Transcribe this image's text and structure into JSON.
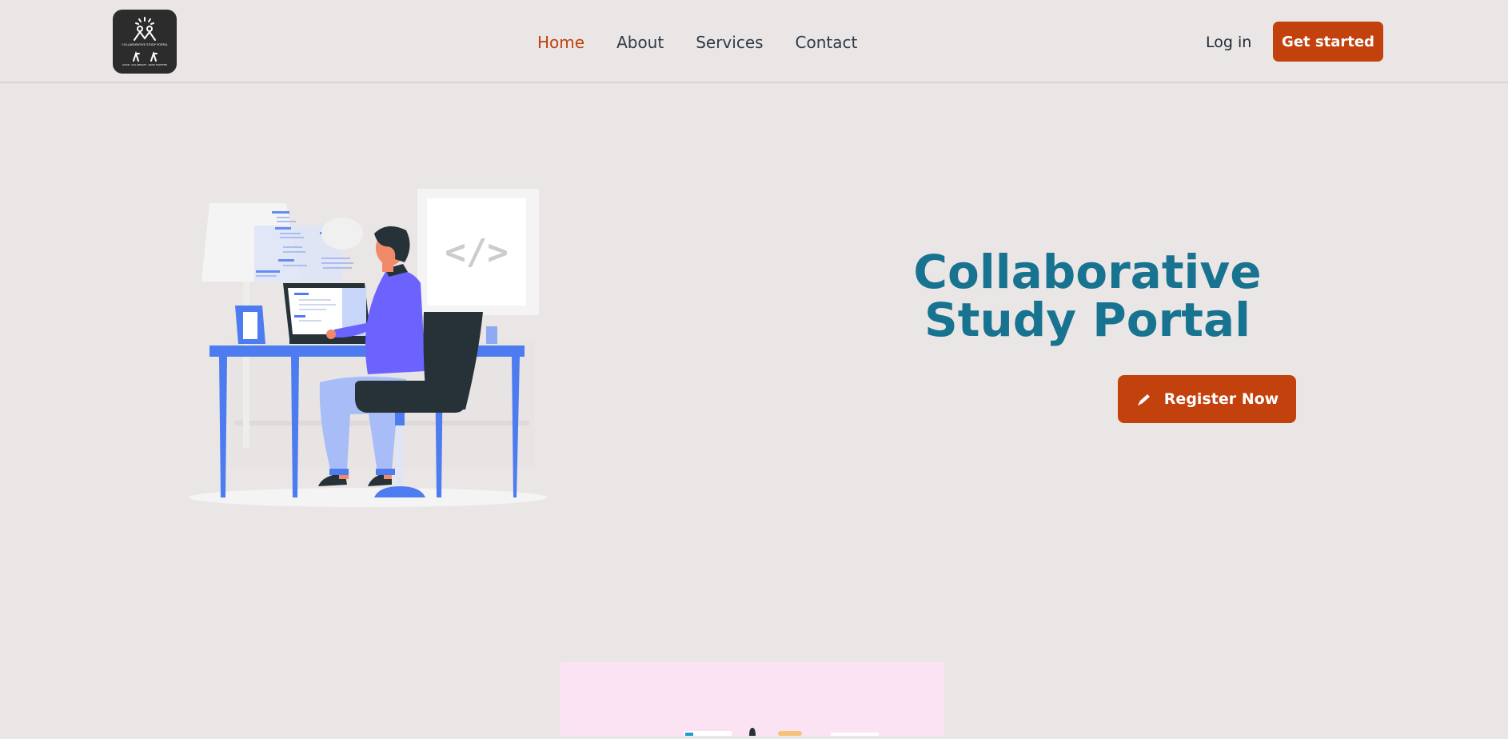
{
  "nav": {
    "links": [
      {
        "label": "Home",
        "active": true
      },
      {
        "label": "About",
        "active": false
      },
      {
        "label": "Services",
        "active": false
      },
      {
        "label": "Contact",
        "active": false
      }
    ],
    "login_label": "Log in",
    "get_started_label": "Get started"
  },
  "logo": {
    "text_top": "COLLABORATIVE STUDY PORTAL",
    "text_bottom": "LEARN · COLLABORATE · GROW TOGETHER"
  },
  "hero": {
    "title": "Collaborative Study Portal",
    "register_label": "Register Now",
    "code_sign": "</>"
  },
  "colors": {
    "accent": "#c2410c",
    "title": "#17738f",
    "background": "#eae6e5"
  }
}
